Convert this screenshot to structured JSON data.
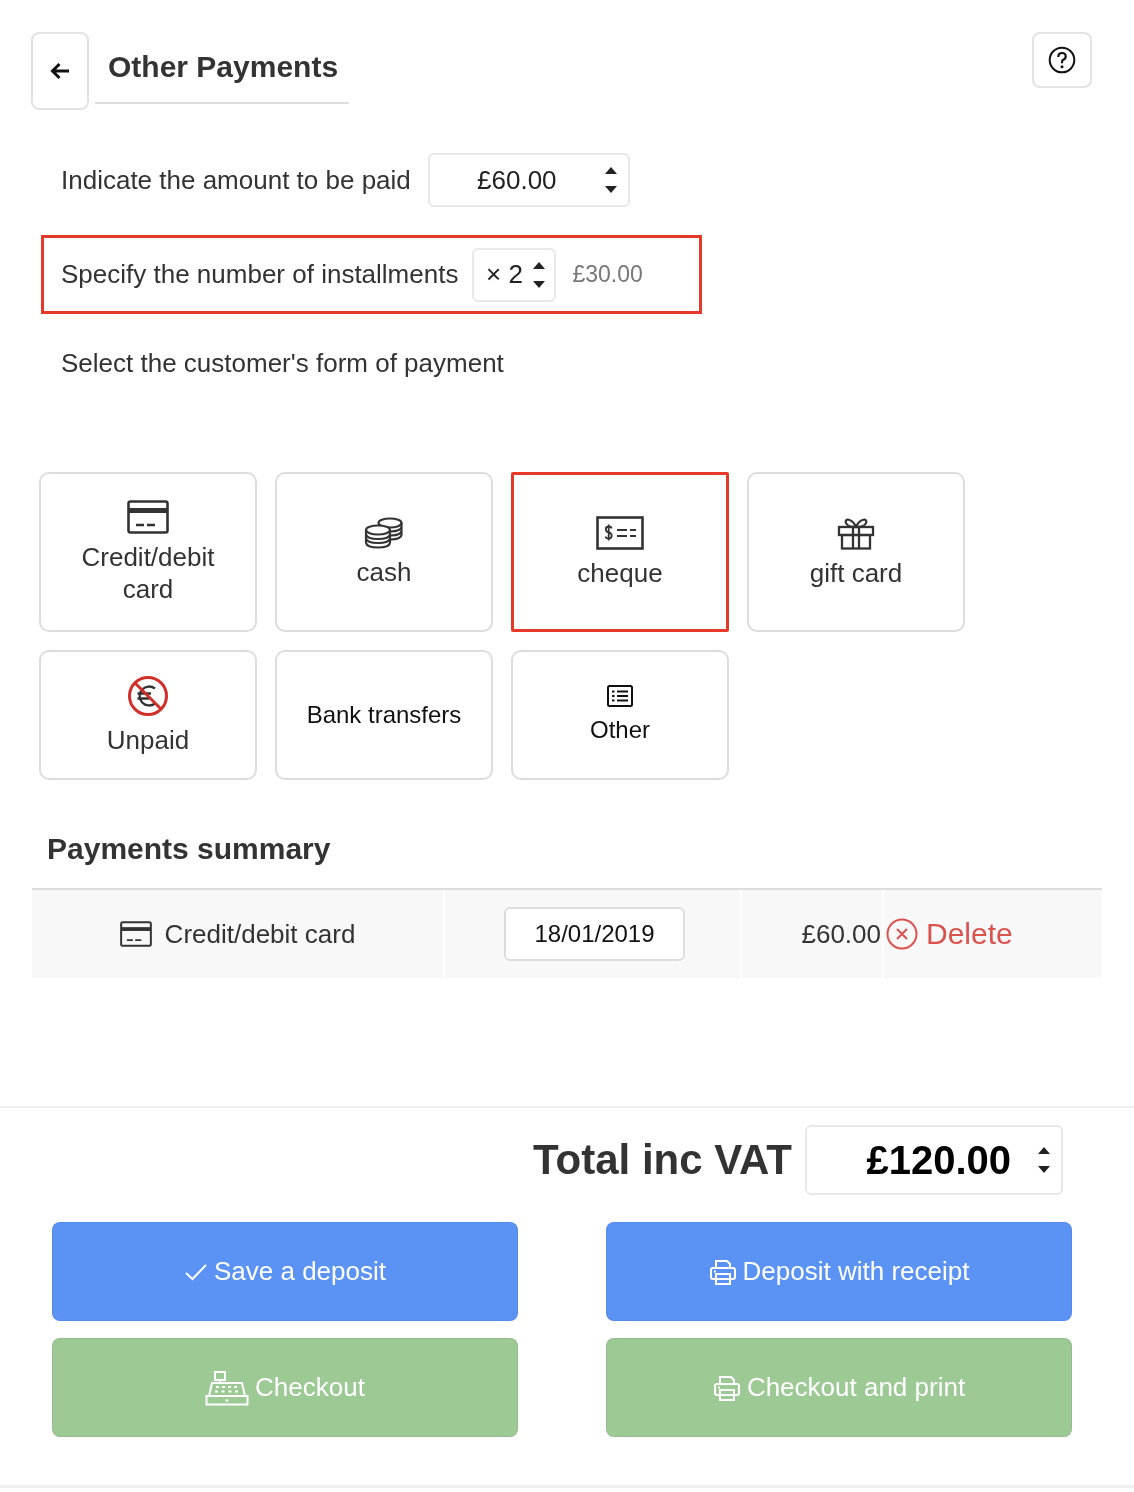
{
  "header": {
    "title": "Other Payments"
  },
  "amount": {
    "label": "Indicate the amount to be paid",
    "value": "£60.00"
  },
  "installments": {
    "label": "Specify the number of installments",
    "value": "× 2",
    "per_installment": "£30.00",
    "highlighted": true
  },
  "payment_prompt": "Select the customer's form of payment",
  "payment_methods": [
    {
      "kind": "card",
      "label": "Credit/debit card",
      "highlighted": false
    },
    {
      "kind": "cash",
      "label": "cash",
      "highlighted": false
    },
    {
      "kind": "cheque",
      "label": "cheque",
      "highlighted": true
    },
    {
      "kind": "gift",
      "label": "gift card",
      "highlighted": false
    },
    {
      "kind": "unpaid",
      "label": "Unpaid",
      "highlighted": false
    },
    {
      "kind": "transfer",
      "label": "Bank transfers",
      "highlighted": false
    },
    {
      "kind": "other",
      "label": "Other",
      "highlighted": false
    }
  ],
  "summary": {
    "title": "Payments summary",
    "rows": [
      {
        "kind": "card",
        "method": "Credit/debit card",
        "date": "18/01/2019",
        "amount": "£60.00",
        "action": "Delete"
      }
    ]
  },
  "total": {
    "label": "Total inc VAT",
    "value": "£120.00"
  },
  "buttons": [
    {
      "kind": "check",
      "label": "Save a deposit",
      "color": "#5b93f5"
    },
    {
      "kind": "printer",
      "label": "Deposit with receipt",
      "color": "#5b93f5"
    },
    {
      "kind": "register",
      "label": "Checkout",
      "color": "#9dc995"
    },
    {
      "kind": "printer",
      "label": "Checkout and print",
      "color": "#9dc995"
    }
  ]
}
